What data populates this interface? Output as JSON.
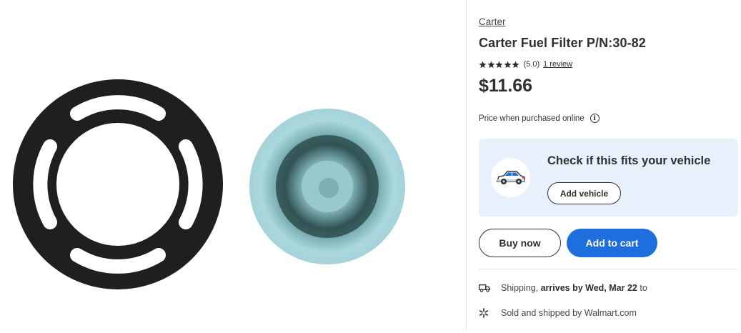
{
  "product": {
    "brand": "Carter",
    "title": "Carter Fuel Filter P/N:30-82",
    "rating": {
      "stars": 5,
      "value_text": "(5.0)",
      "review_text": "1 review"
    },
    "price": "$11.66",
    "price_note": "Price when purchased online"
  },
  "fit_check": {
    "heading": "Check if this fits your vehicle",
    "button": "Add vehicle"
  },
  "actions": {
    "buy_now": "Buy now",
    "add_to_cart": "Add to cart"
  },
  "fulfillment": {
    "shipping_prefix": "Shipping,",
    "arrival": "arrives by Wed, Mar 22",
    "to_text": "to",
    "sold_by": "Sold and shipped by Walmart.com"
  },
  "colors": {
    "primary_blue": "#1e6fdd",
    "card_bg": "#e8f1fb",
    "text_dark": "#2e2f32",
    "filter_teal": "#9fd0d6",
    "gasket_black": "#1f1f1f"
  },
  "icons": {
    "car": "car-icon",
    "shipping": "truck-icon",
    "sold": "spark-icon",
    "info": "info-icon",
    "star": "star-icon"
  }
}
